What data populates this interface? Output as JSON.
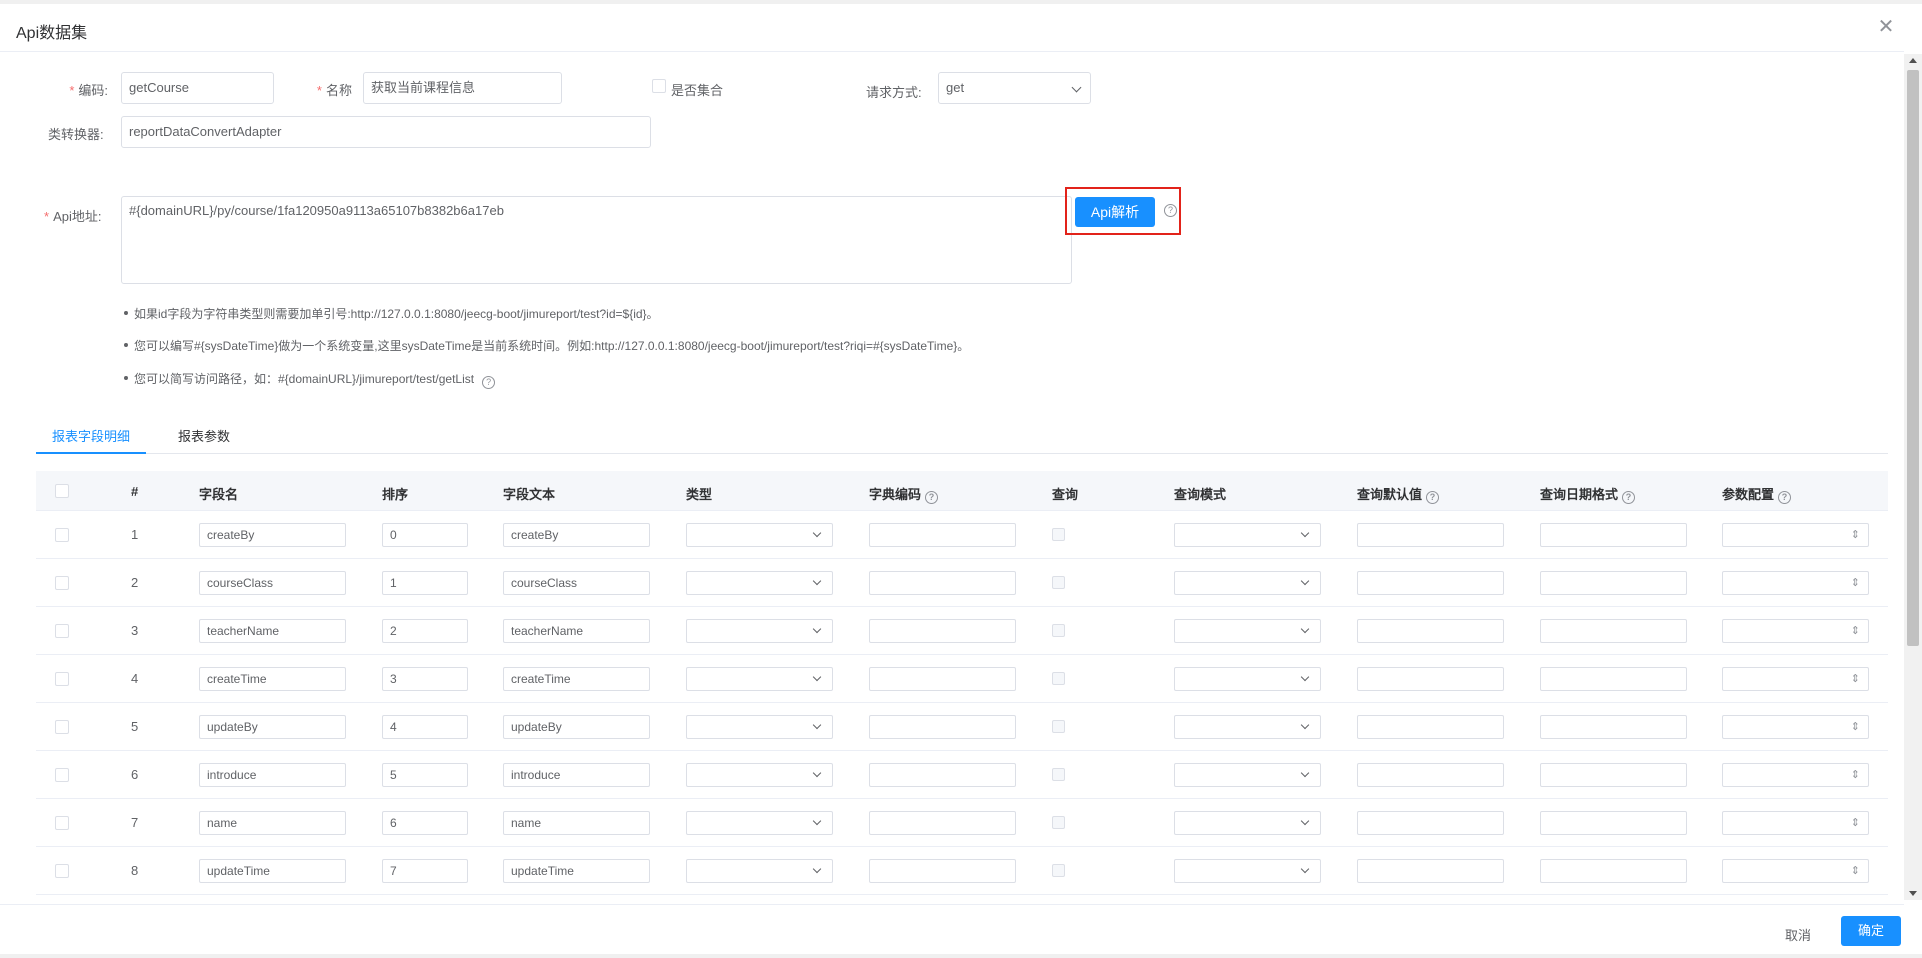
{
  "dialog": {
    "title": "Api数据集",
    "close_icon": "close-icon"
  },
  "form": {
    "code": {
      "label": "编码:",
      "value": "getCourse",
      "required": "*"
    },
    "name": {
      "label": "名称",
      "value": "获取当前课程信息",
      "required": "*"
    },
    "is_collection": {
      "label": "是否集合"
    },
    "request_method": {
      "label": "请求方式:",
      "value": "get"
    },
    "converter": {
      "label": "类转换器:",
      "value": "reportDataConvertAdapter"
    },
    "api_url": {
      "label": "Api地址:",
      "value": "#{domainURL}/py/course/1fa120950a9113a65107b8382b6a17eb",
      "required": "*"
    },
    "api_parse_button": "Api解析"
  },
  "tips": [
    "如果id字段为字符串类型则需要加单引号:http://127.0.0.1:8080/jeecg-boot/jimureport/test?id=${id}。",
    "您可以编写#{sysDateTime}做为一个系统变量,这里sysDateTime是当前系统时间。例如:http://127.0.0.1:8080/jeecg-boot/jimureport/test?riqi=#{sysDateTime}。",
    "您可以简写访问路径，如：#{domainURL}/jimureport/test/getList"
  ],
  "tabs": [
    {
      "label": "报表字段明细",
      "active": true
    },
    {
      "label": "报表参数",
      "active": false
    }
  ],
  "table": {
    "headers": [
      "#",
      "字段名",
      "排序",
      "字段文本",
      "类型",
      "字典编码",
      "查询",
      "查询模式",
      "查询默认值",
      "查询日期格式",
      "参数配置"
    ],
    "rows": [
      {
        "index": "1",
        "field": "createBy",
        "order": "0",
        "text": "createBy"
      },
      {
        "index": "2",
        "field": "courseClass",
        "order": "1",
        "text": "courseClass"
      },
      {
        "index": "3",
        "field": "teacherName",
        "order": "2",
        "text": "teacherName"
      },
      {
        "index": "4",
        "field": "createTime",
        "order": "3",
        "text": "createTime"
      },
      {
        "index": "5",
        "field": "updateBy",
        "order": "4",
        "text": "updateBy"
      },
      {
        "index": "6",
        "field": "introduce",
        "order": "5",
        "text": "introduce"
      },
      {
        "index": "7",
        "field": "name",
        "order": "6",
        "text": "name"
      },
      {
        "index": "8",
        "field": "updateTime",
        "order": "7",
        "text": "updateTime"
      }
    ]
  },
  "footer": {
    "cancel": "取消",
    "confirm": "确定"
  },
  "colors": {
    "primary": "#1890ff",
    "required": "#f56c6c",
    "highlight": "#e2231a"
  }
}
